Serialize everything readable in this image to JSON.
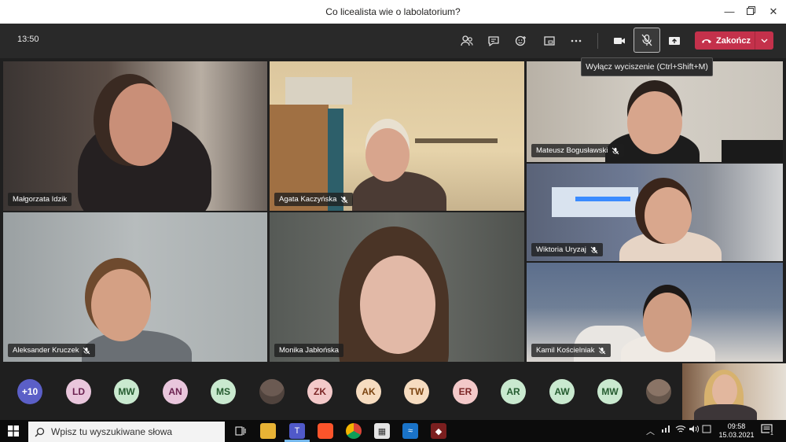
{
  "window": {
    "title": "Co licealista wie o labolatorium?"
  },
  "meeting": {
    "clock": "13:50",
    "end_call_label": "Zakończ",
    "tooltip": "Wyłącz wyciszenie (Ctrl+Shift+M)"
  },
  "tiles": [
    {
      "name": "Małgorzata Idzik",
      "muted": false
    },
    {
      "name": "Agata Kaczyńska",
      "muted": true
    },
    {
      "name": "Mateusz Bogusławski",
      "muted": true
    },
    {
      "name": "Wiktoria Uryzaj",
      "muted": true
    },
    {
      "name": "Aleksander Kruczek",
      "muted": true
    },
    {
      "name": "Monika Jabłońska",
      "muted": false
    },
    {
      "name": "Kamil Kościelniak",
      "muted": true
    }
  ],
  "avatars": [
    {
      "initials": "+10",
      "bg": "#5b5fc7",
      "fg": "#ffffff"
    },
    {
      "initials": "LD",
      "bg": "#e9c6dc",
      "fg": "#6b2250"
    },
    {
      "initials": "MW",
      "bg": "#c9e9cf",
      "fg": "#245b2f"
    },
    {
      "initials": "AN",
      "bg": "#e9c6dc",
      "fg": "#6b2250"
    },
    {
      "initials": "MS",
      "bg": "#c9e9cf",
      "fg": "#245b2f"
    },
    {
      "initials": "",
      "bg": "#6b5a52",
      "fg": "#ffffff"
    },
    {
      "initials": "ZK",
      "bg": "#f3c9c9",
      "fg": "#7a2525"
    },
    {
      "initials": "AK",
      "bg": "#f6dcc0",
      "fg": "#7a4310"
    },
    {
      "initials": "TW",
      "bg": "#f6dcc0",
      "fg": "#7a4310"
    },
    {
      "initials": "ER",
      "bg": "#f3c9c9",
      "fg": "#7a2525"
    },
    {
      "initials": "AR",
      "bg": "#c9e9cf",
      "fg": "#245b2f"
    },
    {
      "initials": "AW",
      "bg": "#c9e9cf",
      "fg": "#245b2f"
    },
    {
      "initials": "MW",
      "bg": "#c9e9cf",
      "fg": "#245b2f"
    },
    {
      "initials": "",
      "bg": "#8a7466",
      "fg": "#ffffff"
    }
  ],
  "taskbar": {
    "search_placeholder": "Wpisz tu wyszukiwane słowa",
    "time": "09:58",
    "date": "15.03.2021",
    "notification_count": "1"
  },
  "colors": {
    "end_call": "#c4314b",
    "accent": "#5b5fc7"
  }
}
